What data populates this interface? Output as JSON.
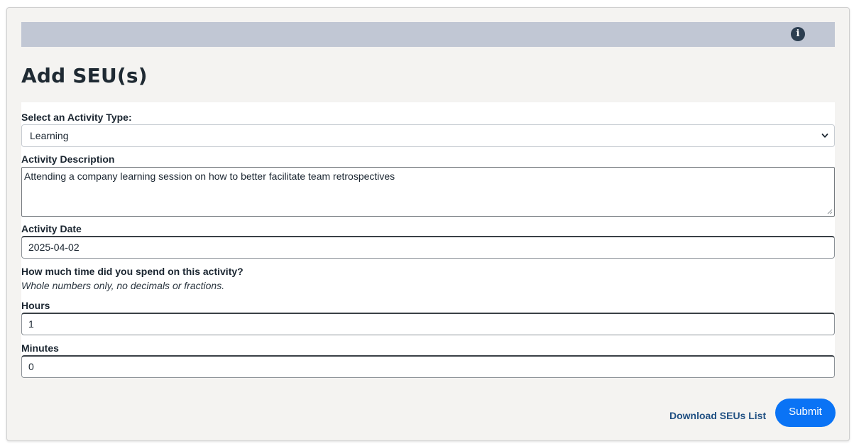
{
  "header": {
    "info_icon": "info-icon",
    "info_glyph": "i"
  },
  "title": "Add SEU(s)",
  "form": {
    "activity_type_label": "Select an Activity Type:",
    "activity_type_value": "Learning",
    "description_label": "Activity Description",
    "description_value": "Attending a company learning session on how to better facilitate team retrospectives",
    "date_label": "Activity Date",
    "date_value": "2025-04-02",
    "time_question": "How much time did you spend on this activity?",
    "time_hint": "Whole numbers only, no decimals or fractions.",
    "hours_label": "Hours",
    "hours_value": "1",
    "minutes_label": "Minutes",
    "minutes_value": "0"
  },
  "footer": {
    "download_label": "Download SEUs List",
    "submit_label": "Submit"
  },
  "colors": {
    "header_bar": "#c1c7d4",
    "card_background": "#f4f3f1",
    "submit_button": "#0a73f5",
    "link": "#1f4f82"
  }
}
